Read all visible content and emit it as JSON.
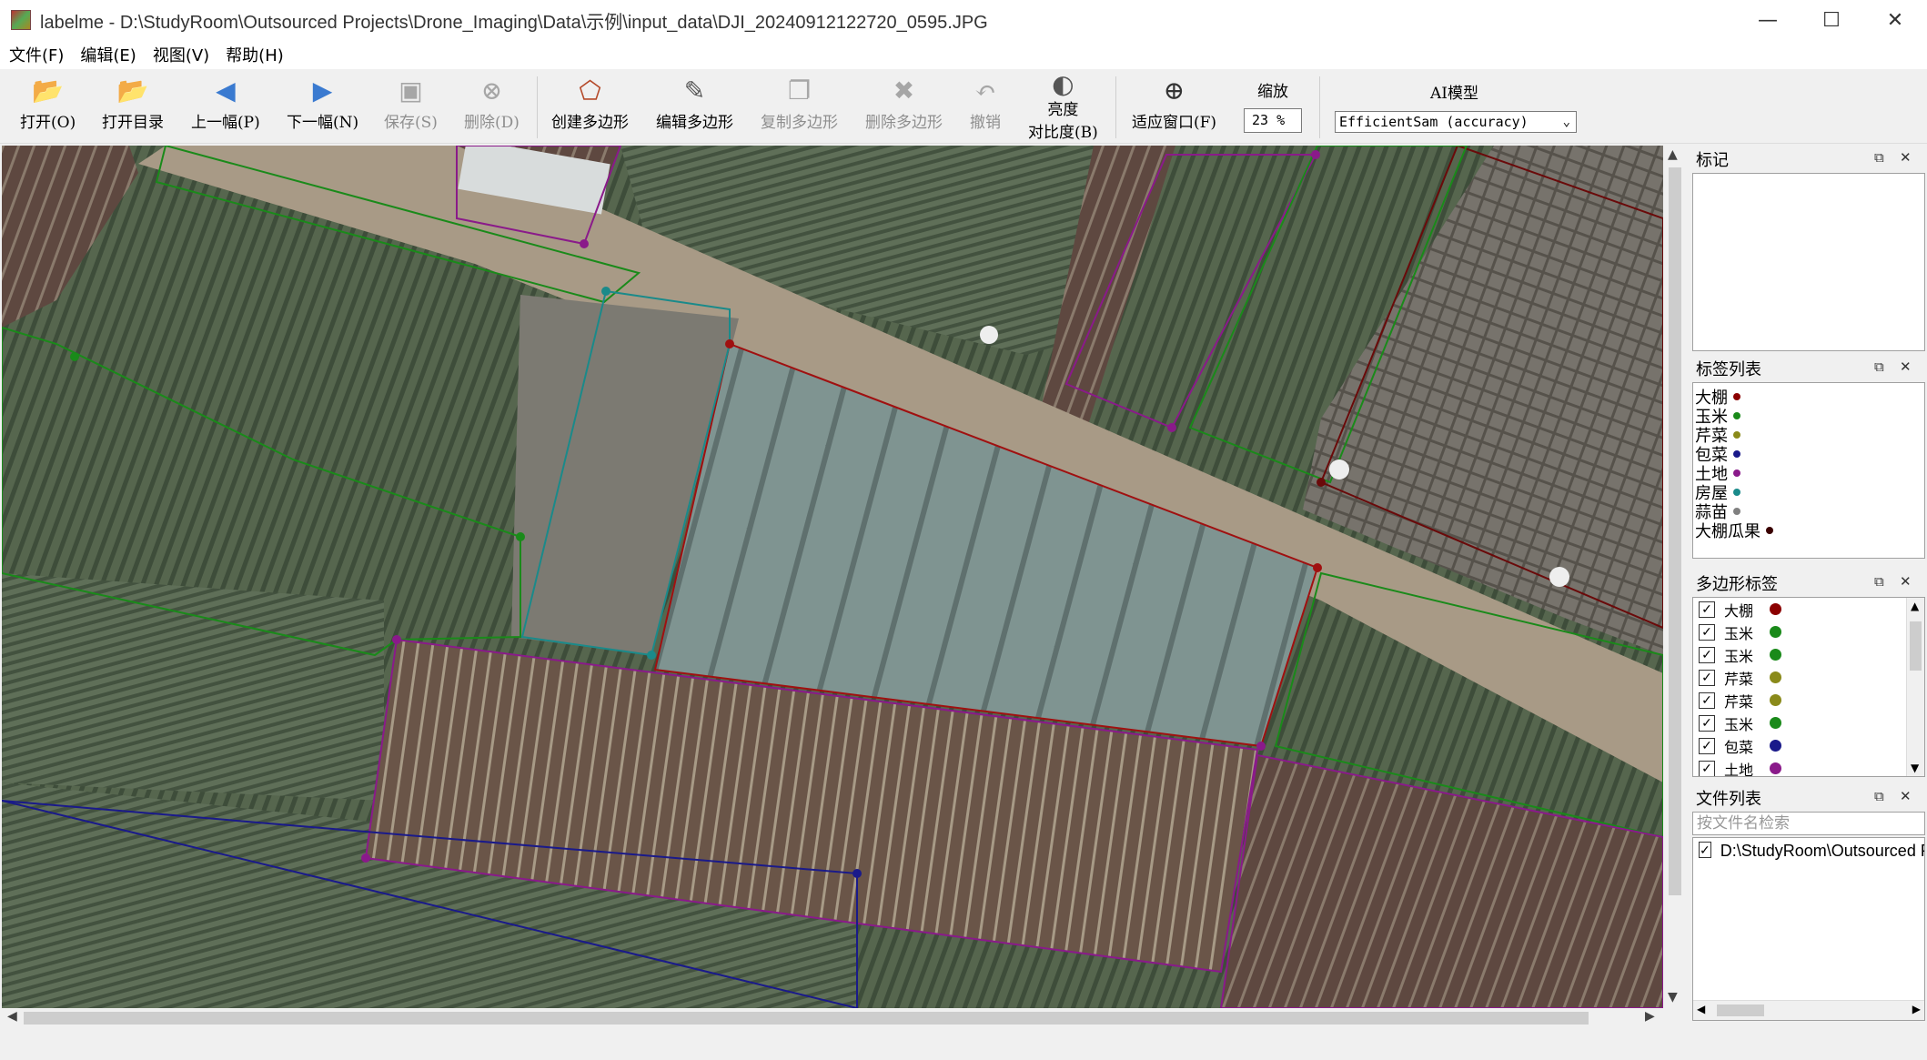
{
  "window": {
    "title": "labelme - D:\\StudyRoom\\Outsourced Projects\\Drone_Imaging\\Data\\示例\\input_data\\DJI_20240912122720_0595.JPG",
    "minimize": "—",
    "maximize": "☐",
    "close": "✕"
  },
  "menu": [
    "文件(F)",
    "编辑(E)",
    "视图(V)",
    "帮助(H)"
  ],
  "toolbar": {
    "open": "打开(O)",
    "open_dir": "打开目录",
    "prev": "上一幅(P)",
    "next": "下一幅(N)",
    "save": "保存(S)",
    "delete": "删除(D)",
    "create_polygon": "创建多边形",
    "edit_polygon": "编辑多边形",
    "copy_polygon": "复制多边形",
    "delete_polygon": "删除多边形",
    "undo": "撤销",
    "brightness_line1": "亮度",
    "brightness_line2": "对比度(B)",
    "fit_window": "适应窗口(F)",
    "zoom_label": "缩放",
    "zoom_value": "23 %",
    "ai_label": "AI模型",
    "ai_model": "EfficientSam (accuracy)"
  },
  "docks": {
    "flags_title": "标记",
    "label_list_title": "标签列表",
    "polygon_labels_title": "多边形标签",
    "file_list_title": "文件列表",
    "file_search_placeholder": "按文件名检索"
  },
  "label_list": [
    {
      "name": "大棚",
      "color": "#8b0000"
    },
    {
      "name": "玉米",
      "color": "#1a8a1a"
    },
    {
      "name": "芹菜",
      "color": "#8a8a1a"
    },
    {
      "name": "包菜",
      "color": "#1a1a8a"
    },
    {
      "name": "土地",
      "color": "#8a1a8a"
    },
    {
      "name": "房屋",
      "color": "#1a8a8a"
    },
    {
      "name": "蒜苗",
      "color": "#808080"
    },
    {
      "name": "大棚瓜果",
      "color": "#3a0000"
    }
  ],
  "polygon_labels": [
    {
      "name": "大棚",
      "color": "#8b0000"
    },
    {
      "name": "玉米",
      "color": "#1a8a1a"
    },
    {
      "name": "玉米",
      "color": "#1a8a1a"
    },
    {
      "name": "芹菜",
      "color": "#8a8a1a"
    },
    {
      "name": "芹菜",
      "color": "#8a8a1a"
    },
    {
      "name": "玉米",
      "color": "#1a8a1a"
    },
    {
      "name": "包菜",
      "color": "#1a1a8a"
    },
    {
      "name": "土地",
      "color": "#8a1a8a"
    }
  ],
  "files": [
    "D:\\StudyRoom\\Outsourced Projects\\Drone_Imaging\\Data\\示例\\input_data\\DJI_20240912122720_0595.JPG"
  ]
}
